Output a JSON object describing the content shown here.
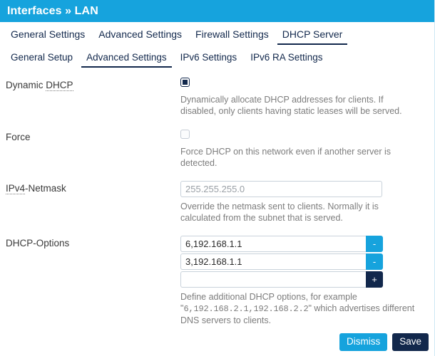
{
  "header": {
    "title": "Interfaces » LAN",
    "bar_color": "#16a3dd"
  },
  "tabs_primary": [
    {
      "label": "General Settings",
      "active": false
    },
    {
      "label": "Advanced Settings",
      "active": false
    },
    {
      "label": "Firewall Settings",
      "active": false
    },
    {
      "label": "DHCP Server",
      "active": true
    }
  ],
  "tabs_secondary": [
    {
      "label": "General Setup",
      "active": false
    },
    {
      "label": "Advanced Settings",
      "active": true
    },
    {
      "label": "IPv6 Settings",
      "active": false
    },
    {
      "label": "IPv6 RA Settings",
      "active": false
    }
  ],
  "fields": {
    "dynamic_dhcp": {
      "label_prefix": "Dynamic ",
      "label_abbr": "DHCP",
      "checked": true,
      "hint": "Dynamically allocate DHCP addresses for clients. If disabled, only clients having static leases will be served."
    },
    "force": {
      "label": "Force",
      "checked": false,
      "hint": "Force DHCP on this network even if another server is detected."
    },
    "ipv4_netmask": {
      "label_abbr": "IPv4",
      "label_suffix": "-Netmask",
      "value": "",
      "placeholder": "255.255.255.0",
      "hint": "Override the netmask sent to clients. Normally it is calculated from the subnet that is served."
    },
    "dhcp_options": {
      "label": "DHCP-Options",
      "rows": [
        {
          "value": "6,192.168.1.1",
          "placeholder": "",
          "button": "-"
        },
        {
          "value": "3,192.168.1.1",
          "placeholder": "",
          "button": "-"
        },
        {
          "value": "",
          "placeholder": "",
          "button": "+"
        }
      ],
      "hint_part1": "Define additional DHCP options, for example \"",
      "hint_mono": "6,192.168.2.1,192.168.2.2",
      "hint_part2": "\" which advertises different DNS servers to clients."
    }
  },
  "footer": {
    "dismiss_label": "Dismiss",
    "save_label": "Save",
    "dismiss_color": "#16a3dd",
    "save_color": "#12284c"
  }
}
